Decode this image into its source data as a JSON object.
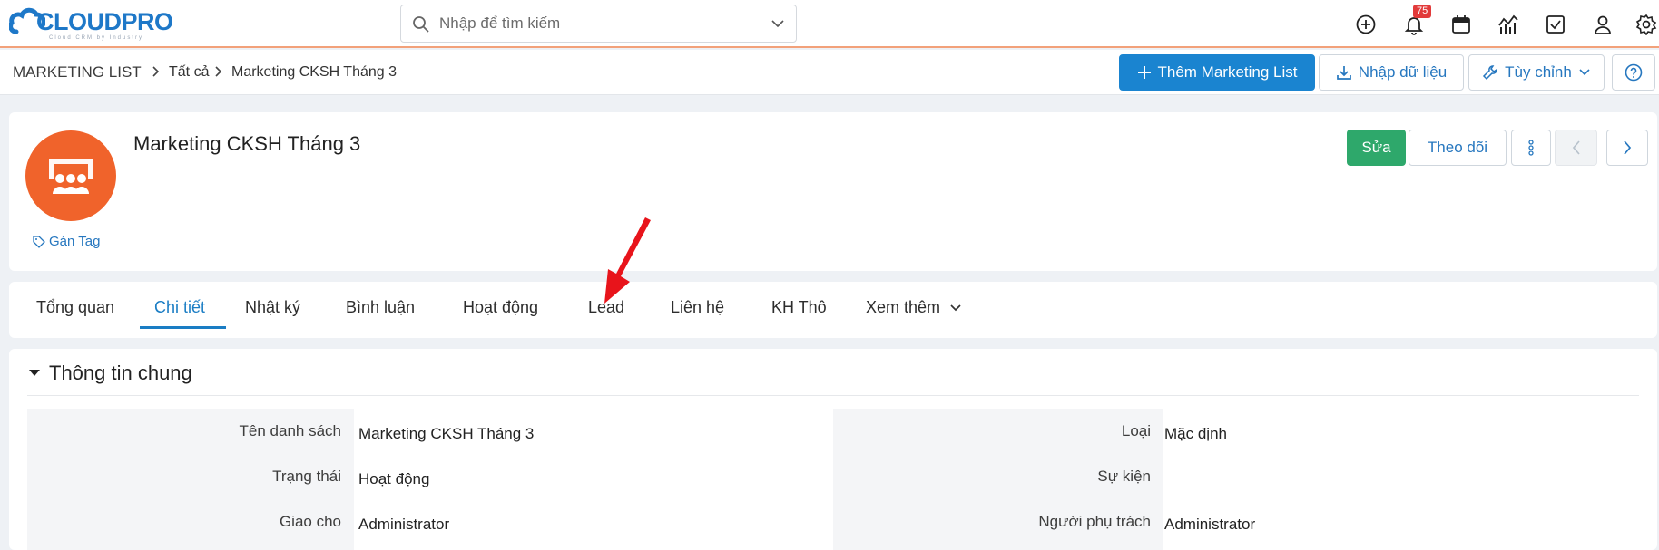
{
  "app": {
    "logo_text": "CLOUDPRO",
    "logo_subtext": "Cloud CRM by Industry"
  },
  "search": {
    "placeholder": "Nhập để tìm kiếm"
  },
  "notifications": {
    "count": "75"
  },
  "breadcrumb": {
    "module": "MARKETING LIST",
    "filter": "Tất cả",
    "record": "Marketing CKSH Tháng 3"
  },
  "toolbar": {
    "add_label": "Thêm Marketing List",
    "import_label": "Nhập dữ liệu",
    "customize_label": "Tùy chỉnh"
  },
  "record": {
    "title": "Marketing CKSH Tháng 3",
    "tag_label": "Gán Tag",
    "edit_label": "Sửa",
    "follow_label": "Theo dõi"
  },
  "tabs": [
    {
      "label": "Tổng quan"
    },
    {
      "label": "Chi tiết"
    },
    {
      "label": "Nhật ký"
    },
    {
      "label": "Bình luận"
    },
    {
      "label": "Hoạt động"
    },
    {
      "label": "Lead"
    },
    {
      "label": "Liên hệ"
    },
    {
      "label": "KH Thô"
    },
    {
      "label": "Xem thêm"
    }
  ],
  "active_tab": "Chi tiết",
  "section": {
    "title": "Thông tin chung",
    "left_fields": [
      {
        "label": "Tên danh sách",
        "value": "Marketing CKSH Tháng 3"
      },
      {
        "label": "Trạng thái",
        "value": "Hoạt động"
      },
      {
        "label": "Giao cho",
        "value": "Administrator"
      }
    ],
    "right_fields": [
      {
        "label": "Loại",
        "value": "Mặc định"
      },
      {
        "label": "Sự kiện",
        "value": ""
      },
      {
        "label": "Người phụ trách",
        "value": "Administrator"
      }
    ]
  },
  "colors": {
    "primary": "#1a84d0",
    "success": "#2ea86b",
    "avatar": "#f0632b",
    "badge": "#e23b3b",
    "annotation_arrow": "#e8141b"
  },
  "icons": [
    "search-icon",
    "chevron-down-icon",
    "plus-circle-icon",
    "bell-icon",
    "calendar-icon",
    "chart-icon",
    "checkbox-icon",
    "user-icon",
    "gear-icon",
    "plus-icon",
    "download-icon",
    "wrench-icon",
    "help-icon",
    "tag-icon",
    "more-icon",
    "chevron-left-icon",
    "chevron-right-icon",
    "caret-down-icon",
    "group-icon"
  ]
}
